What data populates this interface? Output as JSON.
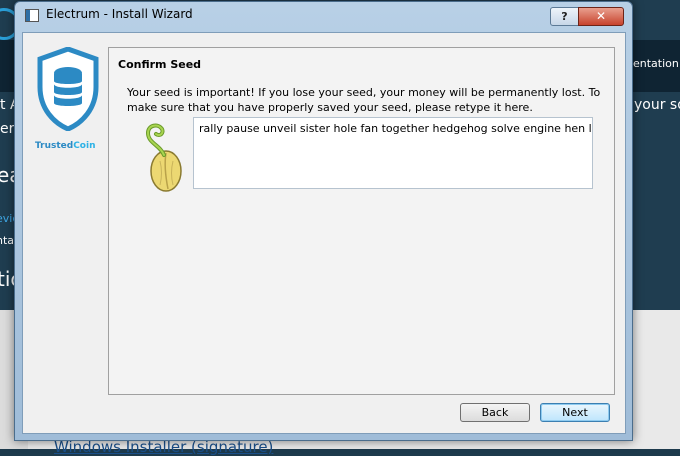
{
  "background": {
    "texts": {
      "header_right": "entation",
      "right_line": "your so",
      "left_a": "t A",
      "left_er": "er",
      "left_ea": "ea",
      "left_vic": "evic",
      "left_nta": "nta",
      "left_tic": "tic"
    },
    "link": "Windows Installer (signature)"
  },
  "window": {
    "title": "Electrum  -  Install Wizard",
    "help_label": "?",
    "close_label": "✕"
  },
  "logo": {
    "part1": "Trusted",
    "part2": "Coin"
  },
  "page": {
    "heading": "Confirm Seed",
    "message": "Your seed is important! If you lose your seed, your money will be permanently lost. To make sure that you have properly saved your seed, please retype it here.",
    "seed_value": "rally pause unveil sister hole fan together hedgehog solve engine hen long"
  },
  "buttons": {
    "back": "Back",
    "next": "Next"
  },
  "colors": {
    "brand": "#2c8ac4",
    "page_bg": "#1f3d50"
  }
}
